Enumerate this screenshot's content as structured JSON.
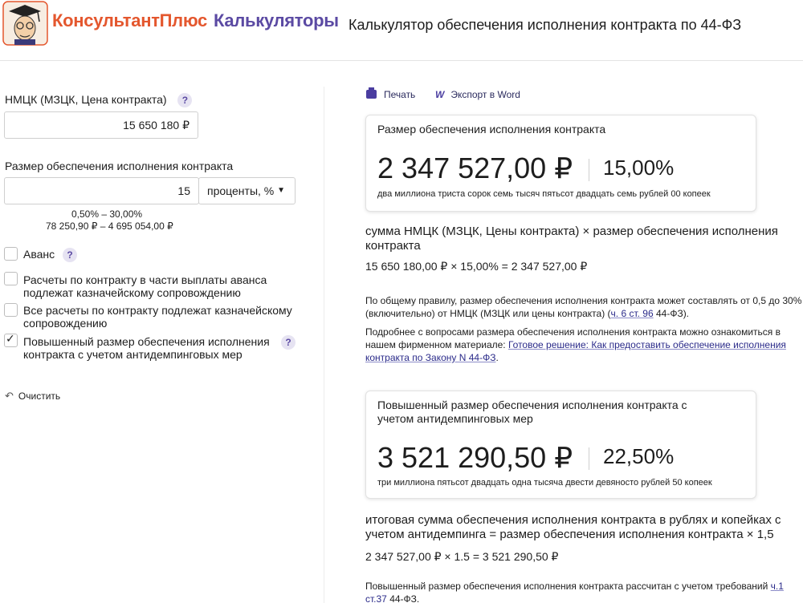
{
  "header": {
    "brand": "КонсультантПлюс",
    "product": "Калькуляторы",
    "title": "Калькулятор обеспечения исполнения контракта по 44-ФЗ"
  },
  "form": {
    "nmck": {
      "label": "НМЦК (МЗЦК, Цена контракта)",
      "help": "?",
      "value": "15 650 180 ₽"
    },
    "size": {
      "label": "Размер обеспечения исполнения контракта",
      "value": "15",
      "unit": "проценты, %",
      "range_pct": "0,50% – 30,00%",
      "range_rub": "78 250,90 ₽ – 4 695 054,00 ₽"
    },
    "checkboxes": [
      {
        "label": "Аванс",
        "checked": false,
        "help": "?"
      },
      {
        "label": "Расчеты по контракту в части выплаты аванса подлежат казначейскому сопровождению",
        "checked": false
      },
      {
        "label": "Все расчеты по контракту подлежат казначейскому сопровождению",
        "checked": false
      },
      {
        "label": "Повышенный размер обеспечения исполнения контракта с учетом антидемпинговых мер",
        "checked": true,
        "help": "?"
      }
    ],
    "clear_label": "Очистить"
  },
  "actions": {
    "print": "Печать",
    "export": "Экспорт в Word"
  },
  "result1": {
    "title": "Размер обеспечения исполнения контракта",
    "amount": "2 347 527,00 ₽",
    "percent": "15,00%",
    "words": "два миллиона триста сорок семь тысяч пятьсот двадцать семь рублей 00 копеек",
    "formula": "сумма НМЦК (МЗЦК, Цены контракта) × размер обеспечения исполнения контракта",
    "calc": "15 650 180,00 ₽ × 15,00% = 2 347 527,00 ₽",
    "note1_text": "По общему правилу, размер обеспечения исполнения контракта может составлять от 0,5 до 30% (включительно) от НМЦК (МЗЦК или цены контракта) (",
    "note1_link": "ч. 6 ст. 96",
    "note1_tail": " 44-ФЗ).",
    "note2_text": "Подробнее с вопросами размера обеспечения исполнения контракта можно ознакомиться в нашем фирменном материале: ",
    "note2_link": "Готовое решение: Как предоставить обеспечение исполнения контракта по Закону N 44-ФЗ",
    "note2_tail": "."
  },
  "result2": {
    "title": "Повышенный размер обеспечения исполнения контракта с учетом антидемпинговых мер",
    "amount": "3 521 290,50 ₽",
    "percent": "22,50%",
    "words": "три миллиона пятьсот двадцать одна тысяча двести девяносто рублей 50 копеек",
    "formula": "итоговая сумма обеспечения исполнения контракта в рублях и копейках с учетом антидемпинга = размер обеспечения исполнения контракта × 1,5",
    "calc": "2 347 527,00 ₽ × 1.5 = 3 521 290,50 ₽",
    "note_text": "Повышенный размер обеспечения исполнения контракта рассчитан с учетом требований ",
    "note_link": "ч.1 ст.37",
    "note_tail": " 44-ФЗ."
  },
  "colors": {
    "brand": "#e4572e",
    "accent": "#5b4aa3",
    "link": "#2b2b8a"
  }
}
